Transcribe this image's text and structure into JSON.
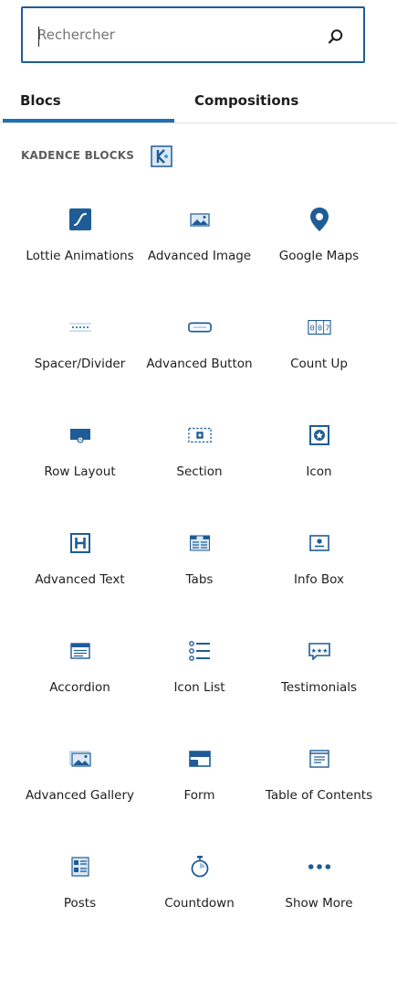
{
  "search": {
    "placeholder": "Rechercher",
    "value": "",
    "icon": "search-icon"
  },
  "tabs": [
    {
      "label": "Blocs",
      "active": true
    },
    {
      "label": "Compositions",
      "active": false
    }
  ],
  "category": {
    "title": "KADENCE BLOCKS",
    "icon": "kadence-logo-icon"
  },
  "colors": {
    "accent": "#1f6fb3",
    "icon": "#1f5c96",
    "border": "#1f5c96"
  },
  "blocks": [
    {
      "label": "Lottie Animations",
      "icon": "lottie-icon"
    },
    {
      "label": "Advanced Image",
      "icon": "image-icon"
    },
    {
      "label": "Google Maps",
      "icon": "map-pin-icon"
    },
    {
      "label": "Spacer/Divider",
      "icon": "spacer-icon"
    },
    {
      "label": "Advanced Button",
      "icon": "button-icon"
    },
    {
      "label": "Count Up",
      "icon": "counter-icon"
    },
    {
      "label": "Row Layout",
      "icon": "row-layout-icon"
    },
    {
      "label": "Section",
      "icon": "section-icon"
    },
    {
      "label": "Icon",
      "icon": "star-icon"
    },
    {
      "label": "Advanced Text",
      "icon": "heading-icon"
    },
    {
      "label": "Tabs",
      "icon": "tabs-icon"
    },
    {
      "label": "Info Box",
      "icon": "info-box-icon"
    },
    {
      "label": "Accordion",
      "icon": "accordion-icon"
    },
    {
      "label": "Icon List",
      "icon": "list-icon"
    },
    {
      "label": "Testimonials",
      "icon": "testimonial-icon"
    },
    {
      "label": "Advanced Gallery",
      "icon": "gallery-icon"
    },
    {
      "label": "Form",
      "icon": "form-icon"
    },
    {
      "label": "Table of Contents",
      "icon": "toc-icon"
    },
    {
      "label": "Posts",
      "icon": "posts-icon"
    },
    {
      "label": "Countdown",
      "icon": "stopwatch-icon"
    },
    {
      "label": "Show More",
      "icon": "more-icon"
    }
  ]
}
